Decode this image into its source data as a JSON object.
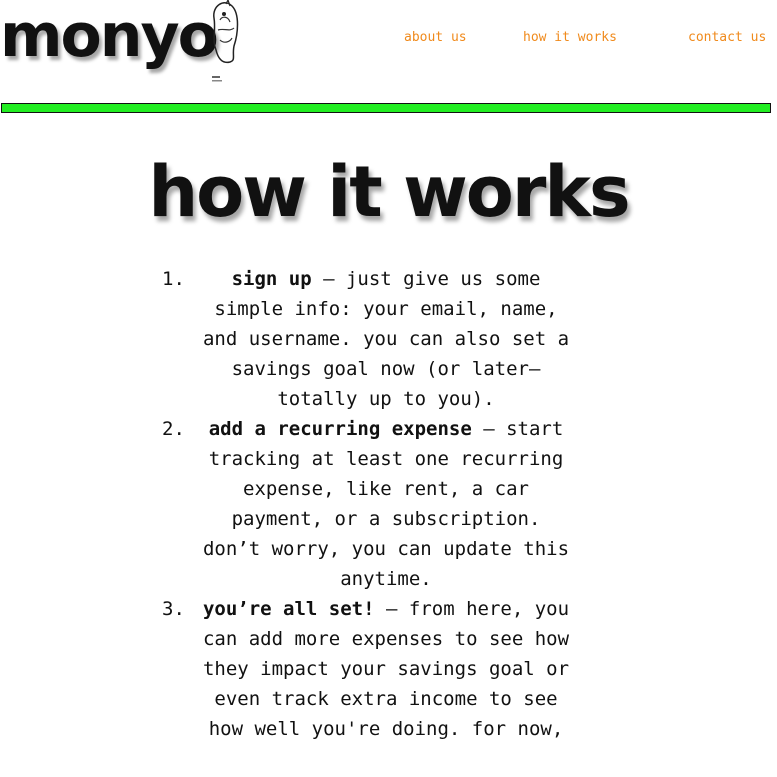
{
  "header": {
    "logo": "monyo",
    "nav": {
      "about": "about us",
      "how": "how it works",
      "contact": "contact us"
    }
  },
  "colors": {
    "accent_bar": "#22ee22",
    "nav_link": "#f08a1c",
    "text": "#111111"
  },
  "main": {
    "title": "how it works",
    "steps": [
      {
        "number": "1.",
        "title": "sign up",
        "text": " – just give us some simple info: your email, name, and username. you can also set a savings goal now (or later–totally up to you)."
      },
      {
        "number": "2.",
        "title": "add a recurring expense",
        "text": " – start tracking at least one recurring expense, like rent, a car payment, or a subscription. don’t worry, you can update this anytime."
      },
      {
        "number": "3.",
        "title": "you’re all set!",
        "text": " – from here, you can add more expenses to see how they impact your savings goal or even track extra income to see how well you're doing. for now,"
      }
    ]
  }
}
